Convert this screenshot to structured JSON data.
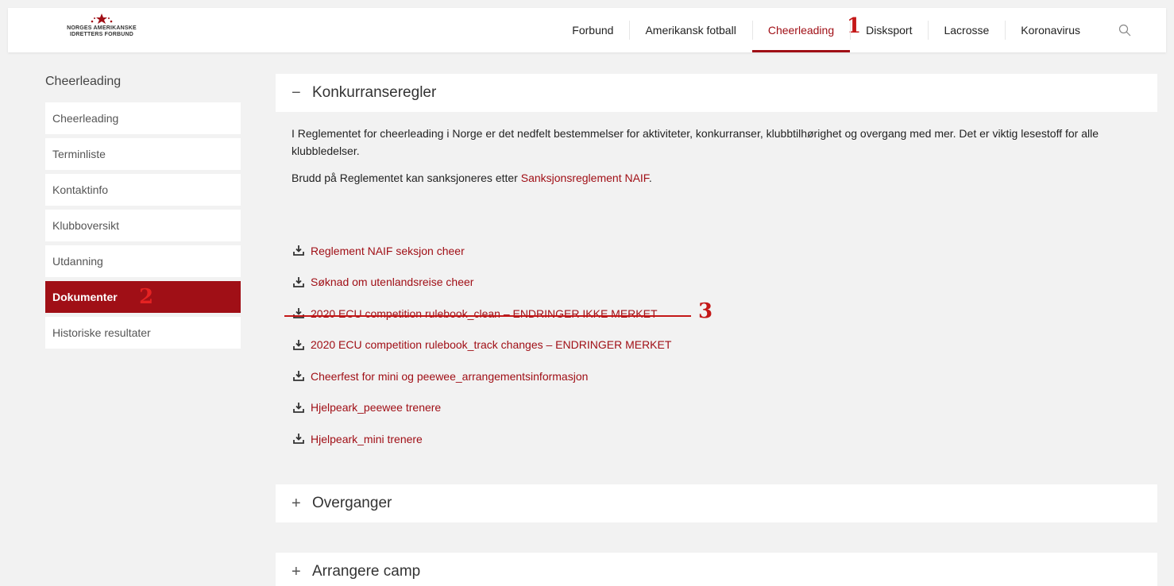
{
  "logo": {
    "line1": "NORGES AMERIKANSKE",
    "line2": "IDRETTERS FORBUND"
  },
  "nav": {
    "items": [
      "Forbund",
      "Amerikansk fotball",
      "Cheerleading",
      "Disksport",
      "Lacrosse",
      "Koronavirus"
    ],
    "active": "Cheerleading",
    "search_icon": "search-icon"
  },
  "annotations": {
    "nav_marker": "1",
    "sidebar_marker": "2",
    "doc_marker": "3"
  },
  "sidebar": {
    "title": "Cheerleading",
    "items": [
      "Cheerleading",
      "Terminliste",
      "Kontaktinfo",
      "Klubboversikt",
      "Utdanning",
      "Dokumenter",
      "Historiske resultater"
    ],
    "active": "Dokumenter"
  },
  "main": {
    "sections": [
      {
        "symbol": "−",
        "title": "Konkurranseregler",
        "expanded": true
      },
      {
        "symbol": "+",
        "title": "Overganger",
        "expanded": false
      },
      {
        "symbol": "+",
        "title": "Arrangere camp",
        "expanded": false
      }
    ],
    "para1": "I Reglementet for cheerleading i Norge er det nedfelt bestemmelser for aktiviteter, konkurranser, klubbtilhørighet og overgang med mer. Det er viktig lesestoff for alle klubbledelser.",
    "para2_prefix": "Brudd på Reglementet kan sanksjoneres etter ",
    "para2_link": "Sanksjonsreglement NAIF",
    "para2_suffix": ".",
    "documents": [
      "Reglement NAIF seksjon cheer",
      "Søknad om utenlandsreise cheer",
      "2020 ECU competition rulebook_clean – ENDRINGER IKKE MERKET",
      "2020 ECU competition rulebook_track changes – ENDRINGER MERKET",
      "Cheerfest for mini og peewee_arrangementsinformasjon",
      "Hjelpeark_peewee trenere",
      "Hjelpeark_mini trenere"
    ],
    "download_icon": "download-icon"
  },
  "colors": {
    "brand": "#a00f16",
    "annotation": "#c41818",
    "background": "#f2f2f2"
  }
}
